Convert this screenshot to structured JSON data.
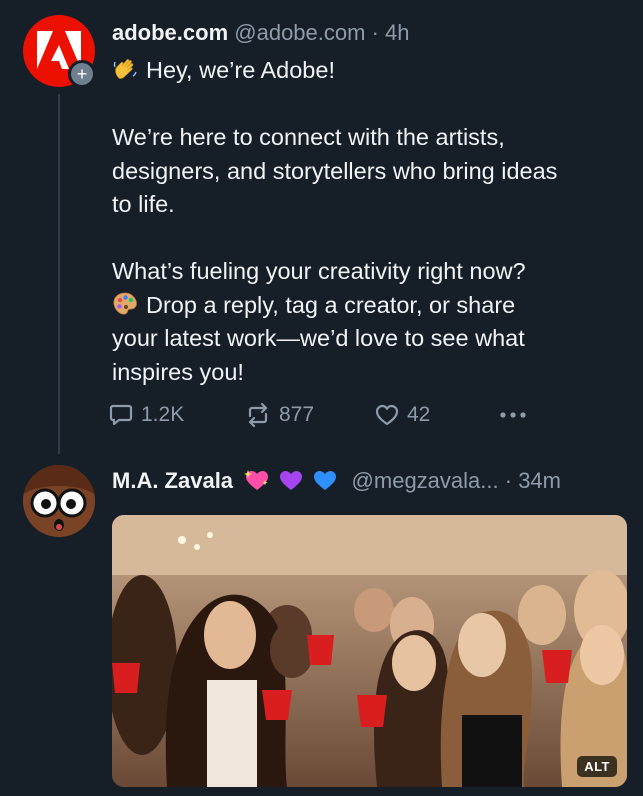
{
  "post1": {
    "display_name": "adobe.com",
    "handle": "@adobe.com",
    "separator": "·",
    "time": "4h",
    "avatar_icon": "adobe-logo-icon",
    "follow_icon": "plus-icon",
    "follow_label": "+",
    "lines": {
      "l1": "Hey, we’re Adobe!",
      "l2": "We’re here to connect with the artists,",
      "l3": "designers, and storytellers who bring ideas",
      "l4": "to life.",
      "l5": "What’s fueling your creativity right now?",
      "l6": "Drop a reply, tag a creator, or share",
      "l7": "your latest work—we’d love to see what",
      "l8": "inspires you!"
    },
    "emoji_wave": "waving-hand-emoji",
    "emoji_palette": "artist-palette-emoji",
    "actions": {
      "reply_count": "1.2K",
      "repost_count": "877",
      "like_count": "42",
      "reply_icon": "reply-icon",
      "repost_icon": "repost-icon",
      "like_icon": "heart-icon",
      "more_icon": "more-dots-icon"
    }
  },
  "post2": {
    "display_name": "M.A. Zavala",
    "name_emojis": [
      "sparkling-heart-emoji",
      "purple-heart-emoji",
      "blue-heart-emoji"
    ],
    "handle": "@megzavala...",
    "separator": "·",
    "time": "34m",
    "media_alt_label": "ALT"
  },
  "colors": {
    "background": "#161e27",
    "text_primary": "#f1f3f5",
    "text_secondary": "#8d9bab",
    "adobe_red": "#eb1000",
    "thread_line": "#2e3b49"
  }
}
